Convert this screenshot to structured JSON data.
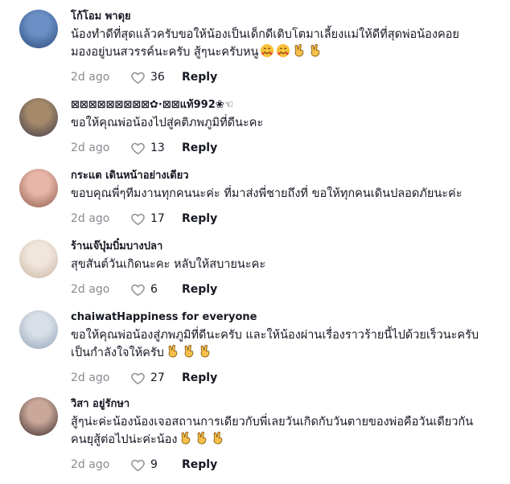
{
  "comments": [
    {
      "name": "โก้โอม พาดุย",
      "text_line1": "น้องทำดีที่สุดแล้วครับขอให้น้องเป็นเด็กดีเติบโตมาเลี้ยงแม่ให้ดีที่สุดพ่อน้องคอย",
      "text_line2": "มองอยู่บนสวรรค์นะครับ สู้ๆนะครับหนู",
      "emojis": [
        "smiling-face-with-hearts-icon",
        "smiling-face-with-hearts-icon",
        "victory-hand-icon",
        "victory-hand-icon"
      ],
      "date": "2d ago",
      "likes": "36",
      "reply": "Reply",
      "avatar_colors": [
        "#6a8fc4",
        "#2b4a7a"
      ]
    },
    {
      "name": "⊠⊠⊠⊠⊠⊠⊠⊠⊠✿·⊠⊠แท้992❀☜",
      "text_line1": "ขอให้คุณพ่อน้องไปสู่คติภพภูมิที่ดีนะคะ",
      "text_line2": "",
      "emojis": [],
      "date": "2d ago",
      "likes": "13",
      "reply": "Reply",
      "avatar_colors": [
        "#a58a6a",
        "#3f3a4a"
      ]
    },
    {
      "name": "กระแต เดินหน้าอย่างเดียว",
      "text_line1": "ขอบคุณพี่ๆทีมงานทุกคนนะค่ะ ที่มาส่งพี่ชายถึงที่ ขอให้ทุกคนเดินปลอดภัยนะค่ะ",
      "text_line2": "",
      "emojis": [],
      "date": "2d ago",
      "likes": "17",
      "reply": "Reply",
      "avatar_colors": [
        "#e8b6a8",
        "#8c5a4a"
      ]
    },
    {
      "name": "ร้านเจ๊บุ๋มบิ๋มบางปลา",
      "text_line1": "สุขสันต์วันเกิดนะคะ หลับให้สบายนะคะ",
      "text_line2": "",
      "emojis": [],
      "date": "2d ago",
      "likes": "6",
      "reply": "Reply",
      "avatar_colors": [
        "#f1e6dc",
        "#c7b4a2"
      ]
    },
    {
      "name": "chaiwatHappiness for everyone",
      "text_line1": "ขอให้คุณพ่อน้องสู่ภพภูมิที่ดีนะครับ และให้น้องผ่านเรื่องราวร้ายนี้ไปด้วยเร็วนะครับ",
      "text_line2": "เป็นกำลังใจให้ครับ",
      "emojis": [
        "victory-hand-icon",
        "victory-hand-icon",
        "victory-hand-icon"
      ],
      "date": "2d ago",
      "likes": "27",
      "reply": "Reply",
      "avatar_colors": [
        "#d9dfe6",
        "#8fa3b8"
      ]
    },
    {
      "name": "วิสา อยู่รักษา",
      "text_line1": "สู้ๆน่ะค่ะน้องน้องเจอสถานการเดียวกับพี่เลยวันเกิดกับวันตายของพ่อคือวันเดียวกัน",
      "text_line2": "คนยุสู้ต่อไปน่ะค่ะน้อง",
      "emojis": [
        "victory-hand-icon",
        "victory-hand-icon",
        "victory-hand-icon"
      ],
      "date": "2d ago",
      "likes": "9",
      "reply": "Reply",
      "avatar_colors": [
        "#c9a89a",
        "#3a2a28"
      ]
    }
  ]
}
